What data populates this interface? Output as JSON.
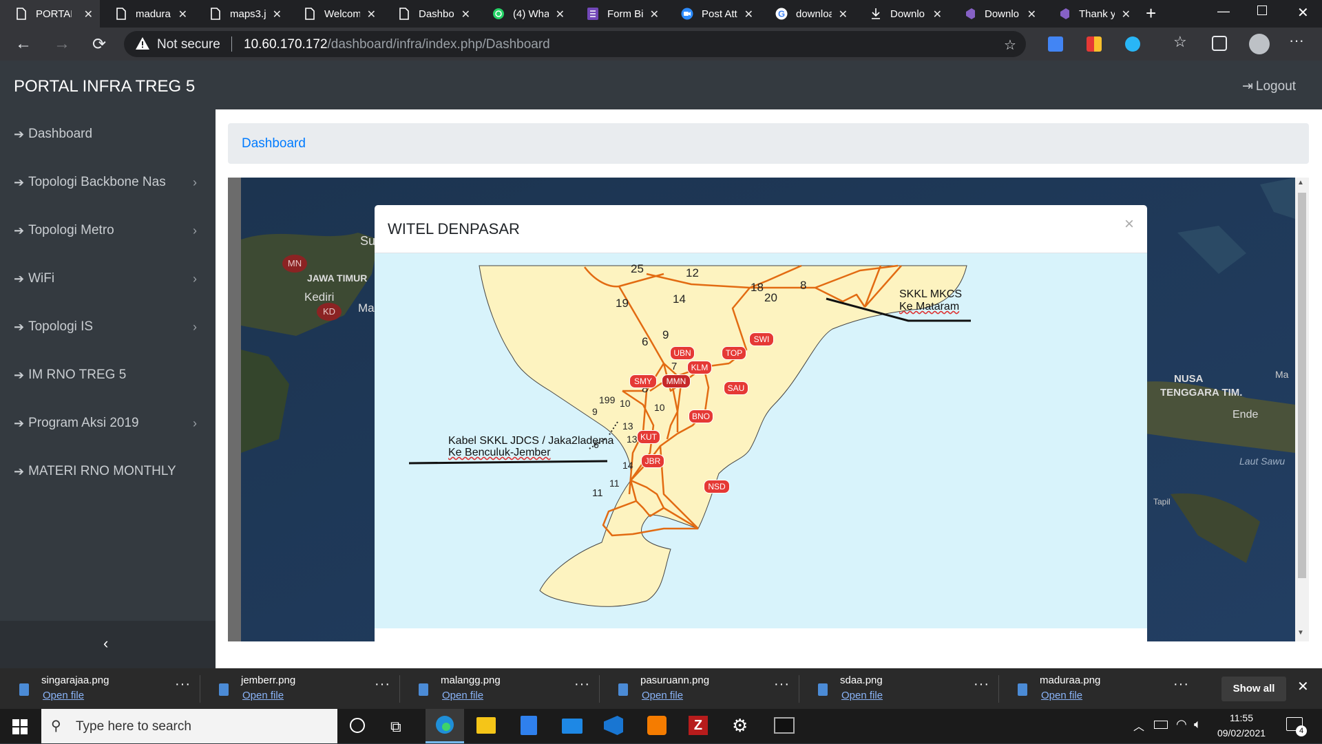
{
  "browser": {
    "tabs": [
      {
        "label": "PORTAL",
        "icon": "page-icon",
        "active": true
      },
      {
        "label": "madura",
        "icon": "page-icon"
      },
      {
        "label": "maps3.j",
        "icon": "page-icon"
      },
      {
        "label": "Welcom",
        "icon": "page-icon"
      },
      {
        "label": "Dashbo",
        "icon": "page-icon"
      },
      {
        "label": "(4) Wha",
        "icon": "whatsapp-icon"
      },
      {
        "label": "Form Bi",
        "icon": "forms-icon"
      },
      {
        "label": "Post Att",
        "icon": "zoom-icon"
      },
      {
        "label": "downloa",
        "icon": "google-icon"
      },
      {
        "label": "Downlo",
        "icon": "download-icon"
      },
      {
        "label": "Downlo",
        "icon": "vs-icon"
      },
      {
        "label": "Thank y",
        "icon": "vs-icon"
      }
    ],
    "security_label": "Not secure",
    "url_host": "10.60.170.172",
    "url_path": "/dashboard/infra/index.php/Dashboard"
  },
  "app": {
    "brand": "PORTAL INFRA TREG 5",
    "logout_label": "Logout",
    "sidebar": [
      {
        "label": "Dashboard",
        "has_children": false
      },
      {
        "label": "Topologi Backbone Nas",
        "has_children": true
      },
      {
        "label": "Topologi Metro",
        "has_children": true
      },
      {
        "label": "WiFi",
        "has_children": true
      },
      {
        "label": "Topologi IS",
        "has_children": true
      },
      {
        "label": "IM RNO TREG 5",
        "has_children": false
      },
      {
        "label": "Program Aksi 2019",
        "has_children": true
      },
      {
        "label": "MATERI RNO MONTHLY",
        "has_children": false
      }
    ],
    "breadcrumb": "Dashboard"
  },
  "background_map": {
    "labels": [
      "MN",
      "JAWA TIMUR",
      "Kediri",
      "KD",
      "Su",
      "Ma",
      "NUSA",
      "TENGGARA TIM.",
      "Ende",
      "Laut Sawu",
      "Tapil",
      "Ma"
    ]
  },
  "modal": {
    "title": "WITEL DENPASAR",
    "close": "×",
    "map": {
      "node_labels": [
        "SWI",
        "UBN",
        "TOP",
        "KLM",
        "SMY",
        "MMN",
        "SAU",
        "BNO",
        "KUT",
        "JBR",
        "NSD"
      ],
      "link_numbers": [
        "25",
        "12",
        "18",
        "8",
        "20",
        "19",
        "14",
        "9",
        "6",
        "7",
        "8",
        "199",
        "10",
        "10",
        "9",
        "13",
        "6",
        "13",
        "14",
        "11",
        "11"
      ],
      "callout_east_line1": "SKKL MKCS",
      "callout_east_line2": "Ke Mataram",
      "callout_west_line1": "Kabel SKKL JDCS / Jaka2ladema",
      "callout_west_line2": "Ke Benculuk-Jember"
    }
  },
  "downloads": {
    "items": [
      {
        "name": "singarajaa.png",
        "action": "Open file"
      },
      {
        "name": "jemberr.png",
        "action": "Open file"
      },
      {
        "name": "malangg.png",
        "action": "Open file"
      },
      {
        "name": "pasuruann.png",
        "action": "Open file"
      },
      {
        "name": "sdaa.png",
        "action": "Open file"
      },
      {
        "name": "maduraa.png",
        "action": "Open file"
      }
    ],
    "show_all": "Show all"
  },
  "taskbar": {
    "search_placeholder": "Type here to search",
    "time": "11:55",
    "date": "09/02/2021",
    "notification_count": "4"
  }
}
